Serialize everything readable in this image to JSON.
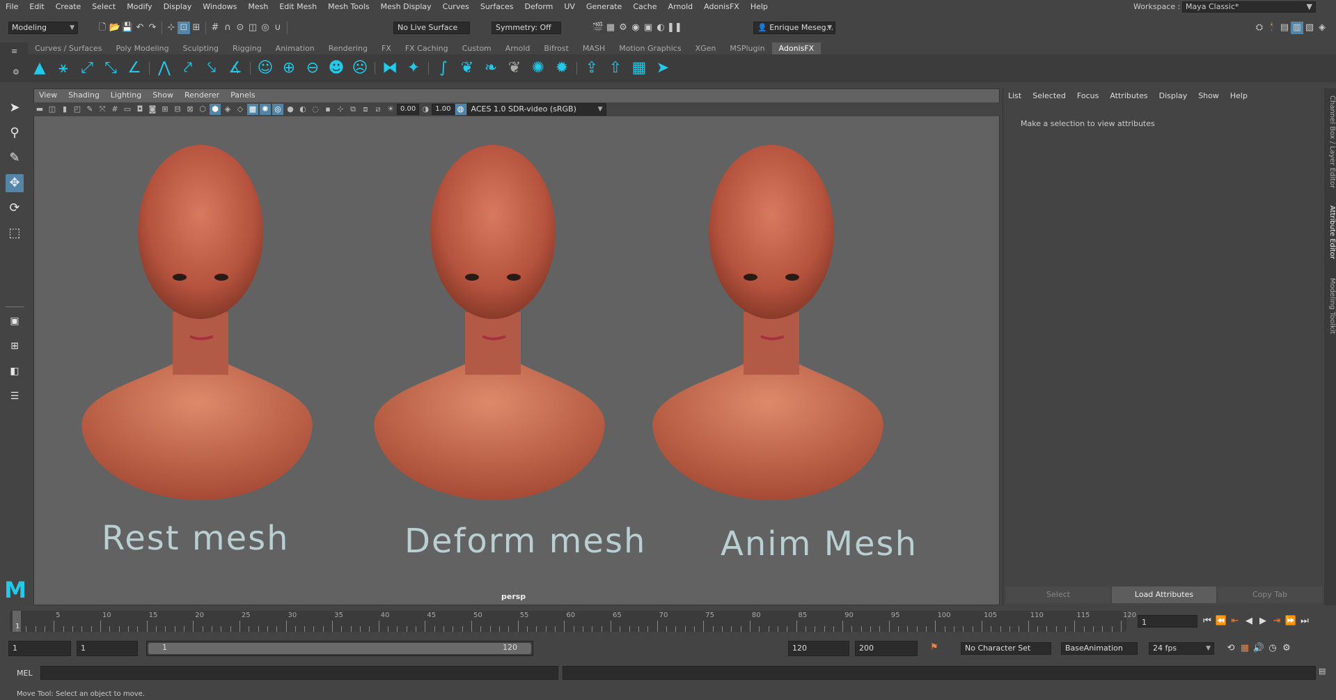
{
  "menubar": {
    "items": [
      "File",
      "Edit",
      "Create",
      "Select",
      "Modify",
      "Display",
      "Windows",
      "Mesh",
      "Edit Mesh",
      "Mesh Tools",
      "Mesh Display",
      "Curves",
      "Surfaces",
      "Deform",
      "UV",
      "Generate",
      "Cache",
      "Arnold",
      "AdonisFX",
      "Help"
    ],
    "workspace_label": "Workspace :",
    "workspace_value": "Maya Classic*"
  },
  "statusline": {
    "menuset": "Modeling",
    "live_surface": "No Live Surface",
    "symmetry": "Symmetry: Off",
    "user": "Enrique Meseg..."
  },
  "shelf": {
    "tabs": [
      "Curves / Surfaces",
      "Poly Modeling",
      "Sculpting",
      "Rigging",
      "Animation",
      "Rendering",
      "FX",
      "FX Caching",
      "Custom",
      "Arnold",
      "Bifrost",
      "MASH",
      "Motion Graphics",
      "XGen",
      "MSPlugin",
      "AdonisFX"
    ],
    "active_tab": "AdonisFX"
  },
  "viewport": {
    "menu": [
      "View",
      "Shading",
      "Lighting",
      "Show",
      "Renderer",
      "Panels"
    ],
    "near_value": "0.00",
    "far_value": "1.00",
    "colorspace": "ACES 1.0 SDR-video (sRGB)",
    "camera": "persp",
    "labels": [
      "Rest mesh",
      "Deform mesh",
      "Anim Mesh"
    ]
  },
  "attribute_editor": {
    "menu": [
      "List",
      "Selected",
      "Focus",
      "Attributes",
      "Display",
      "Show",
      "Help"
    ],
    "message": "Make a selection to view attributes",
    "buttons": [
      "Select",
      "Load Attributes",
      "Copy Tab"
    ],
    "side_tabs": [
      "Channel Box / Layer Editor",
      "Attribute Editor",
      "Modeling Toolkit"
    ]
  },
  "timeline": {
    "ticks": [
      "5",
      "10",
      "15",
      "20",
      "25",
      "30",
      "35",
      "40",
      "45",
      "50",
      "55",
      "60",
      "65",
      "70",
      "75",
      "80",
      "85",
      "90",
      "95",
      "100",
      "105",
      "110",
      "115",
      "120"
    ],
    "start_marker": "1",
    "current_frame": "1"
  },
  "range": {
    "start": "1",
    "playback_start": "1",
    "slider_start": "1",
    "slider_end": "120",
    "playback_end": "120",
    "end": "200",
    "character_set": "No Character Set",
    "anim_layer": "BaseAnimation",
    "fps": "24 fps"
  },
  "cmdline": {
    "label": "MEL"
  },
  "helpline": {
    "text": "Move Tool: Select an object to move."
  },
  "colors": {
    "accent": "#22c9e8",
    "selection": "#5285a6",
    "skin": "#c4664f"
  }
}
